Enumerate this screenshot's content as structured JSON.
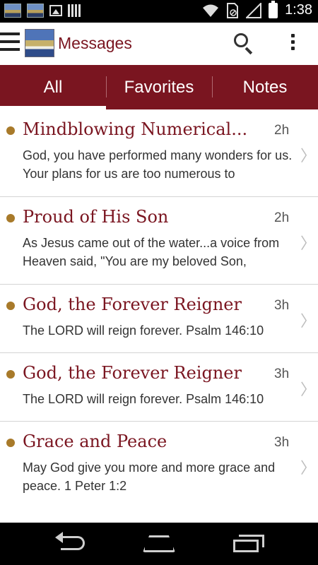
{
  "status_bar": {
    "time": "1:38",
    "icons": [
      "app-thumbnail-icon",
      "app-thumbnail-icon",
      "image-icon",
      "barcode-icon",
      "wifi-icon",
      "no-sim-icon",
      "signal-icon",
      "battery-charging-icon"
    ]
  },
  "app_bar": {
    "title": "Messages",
    "icons": [
      "menu-icon",
      "app-logo",
      "search-icon",
      "overflow-menu-icon"
    ]
  },
  "tabs": [
    {
      "label": "All",
      "active": true
    },
    {
      "label": "Favorites",
      "active": false
    },
    {
      "label": "Notes",
      "active": false
    }
  ],
  "messages": [
    {
      "title": "Mindblowing Numerical...",
      "time": "2h",
      "body": "God, you have performed many wonders for us. Your plans for us are too numerous to"
    },
    {
      "title": "Proud of His Son",
      "time": "2h",
      "body": "As Jesus came out of the water...a voice from Heaven said, \"You are my beloved Son,"
    },
    {
      "title": "God, the Forever Reigner",
      "time": "3h",
      "body": "The LORD will reign forever. Psalm 146:10"
    },
    {
      "title": "God, the Forever Reigner",
      "time": "3h",
      "body": "The LORD will reign forever. Psalm 146:10"
    },
    {
      "title": "Grace and Peace",
      "time": "3h",
      "body": "May God give you more and more grace and peace. 1 Peter 1:2"
    }
  ],
  "colors": {
    "brand": "#7a1520",
    "unread_dot": "#a87a2a",
    "divider": "#d4d4d4"
  },
  "nav_bar": {
    "icons": [
      "back-icon",
      "home-icon",
      "recent-apps-icon"
    ]
  }
}
